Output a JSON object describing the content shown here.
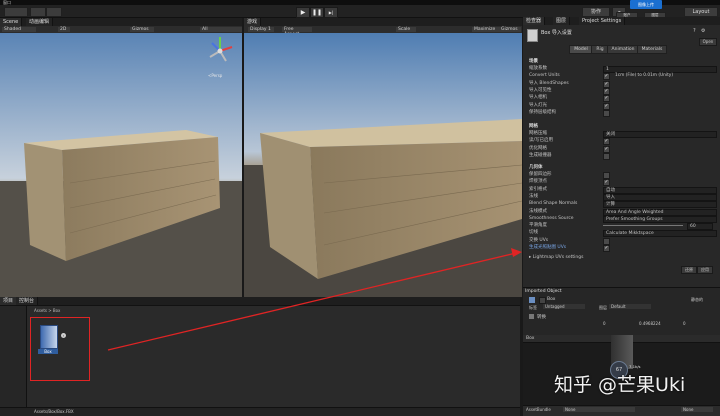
{
  "menubar": {
    "title": "窗口"
  },
  "toolbar": {
    "left_buttons": [
      "",
      ""
    ],
    "play": "▶",
    "pause": "❚❚",
    "step": "▶|",
    "collab": "协作",
    "account": "账户",
    "layers": "图层",
    "layout": "Layout",
    "upload_badge": "图像上传"
  },
  "scene": {
    "tabs": [
      "Scene",
      "动画编辑"
    ],
    "shading": "Shaded",
    "mode": "2D",
    "gizmos": "Gizmos",
    "search": "All",
    "gizmo_label": "<Persp"
  },
  "game": {
    "tabs": [
      "游戏"
    ],
    "display": "Display 1",
    "aspect": "Free Aspect",
    "scale_label": "Scale",
    "maximize": "Maximize",
    "extra": "Gizmos"
  },
  "inspector": {
    "tabs": [
      "检查器",
      "图层",
      "Project Settings"
    ],
    "asset_title": "Box 导入设置",
    "open_button": "Open",
    "model_tabs": [
      "Model",
      "Rig",
      "Animation",
      "Materials"
    ],
    "section_scene": "场景",
    "scene_rows": [
      {
        "label": "缩放系数",
        "value": "1",
        "kind": "value"
      },
      {
        "label": "Convert Units",
        "value": "1cm (File) to 0.01m (Unity)",
        "kind": "check"
      },
      {
        "label": "导入 BlendShapes",
        "value": "",
        "kind": "check"
      },
      {
        "label": "导入可见性",
        "value": "",
        "kind": "check"
      },
      {
        "label": "导入相机",
        "value": "",
        "kind": "check"
      },
      {
        "label": "导入灯光",
        "value": "",
        "kind": "check"
      },
      {
        "label": "保持层级结构",
        "value": "",
        "kind": "empty"
      }
    ],
    "section_meshes": "网格",
    "mesh_rows": [
      {
        "label": "网格压缩",
        "value": "关闭",
        "kind": "value"
      },
      {
        "label": "读/写已启用",
        "value": "",
        "kind": "check"
      },
      {
        "label": "优化网格",
        "value": "",
        "kind": "check"
      },
      {
        "label": "生成碰撞器",
        "value": "",
        "kind": "empty"
      }
    ],
    "section_geometry": "几何体",
    "geometry_rows": [
      {
        "label": "保留四边形",
        "value": "",
        "kind": "empty"
      },
      {
        "label": "焊接顶点",
        "value": "",
        "kind": "check"
      },
      {
        "label": "索引格式",
        "value": "自动",
        "kind": "value"
      },
      {
        "label": "法线",
        "value": "导入",
        "kind": "value"
      },
      {
        "label": "Blend Shape Normals",
        "value": "计算",
        "kind": "value"
      },
      {
        "label": "法线模式",
        "value": "Area And Angle Weighted",
        "kind": "value"
      },
      {
        "label": "Smoothness Source",
        "value": "Prefer Smoothing Groups",
        "kind": "value"
      },
      {
        "label": "平滑角度",
        "value": "60",
        "kind": "slider"
      },
      {
        "label": "切线",
        "value": "Calculate Mikktspace",
        "kind": "value"
      },
      {
        "label": "交换 UVs",
        "value": "",
        "kind": "empty"
      },
      {
        "label": "生成光照贴图 UVs",
        "value": "",
        "kind": "check"
      }
    ],
    "lightmap_foldout": "Lightmap UVs settings",
    "revert_button": "还原",
    "apply_button": "应用",
    "imported_header": "Imported Object",
    "imported_name": "Box",
    "imported_static": "静态的",
    "tag_label": "标签",
    "tag_value": "Untagged",
    "layer_label": "图层",
    "layer_value": "Default",
    "transform_label": "转换",
    "pos_x": "0",
    "pos_y": "0.4968224",
    "pos_z": "0",
    "preview_title": "Box",
    "preview_count": "67",
    "preview_speed": "7.1k/s",
    "assetbundle_label": "AssetBundle",
    "assetbundle_value": "None",
    "assetbundle_variant": "None"
  },
  "project": {
    "tabs": [
      "项目",
      "控制台"
    ],
    "breadcrumb": "Assets > Box",
    "asset_label": "Box",
    "status_path": "Assets/Box/Box.FBX"
  },
  "watermark": "知乎 @芒果Uki",
  "colors": {
    "highlight_box": "#e02424",
    "arrow": "#e02424",
    "accent": "#3a79d0"
  }
}
